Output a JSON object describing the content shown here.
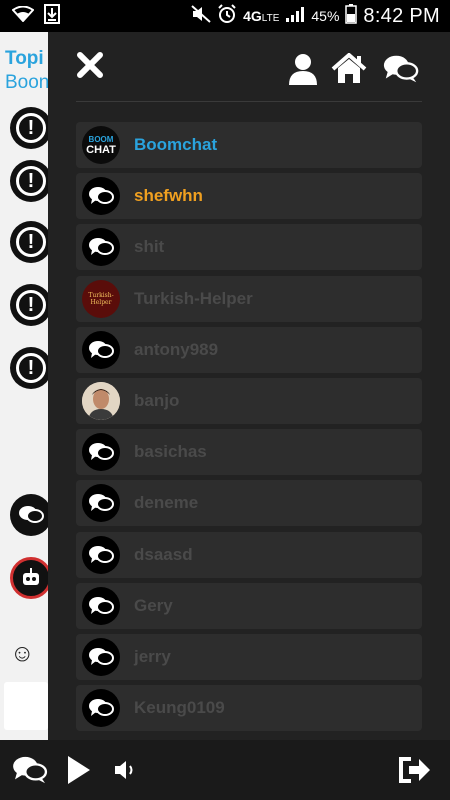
{
  "status": {
    "network": "4G",
    "lte": "LTE",
    "battery": "45%",
    "time": "8:42 PM"
  },
  "background_page": {
    "topic_label": "Topi",
    "topic_sub": "Boon"
  },
  "drawer": {
    "items": [
      {
        "name": "Boomchat",
        "avatar": "boomchat-logo",
        "color": "#2aa3dd",
        "avatar_text_top": "BOOM",
        "avatar_text_bottom": "CHAT"
      },
      {
        "name": "shefwhn",
        "avatar": "chat-bubbles-icon",
        "color": "#f0a020"
      },
      {
        "name": "shit",
        "avatar": "chat-bubbles-icon",
        "color": "#4a4a4a"
      },
      {
        "name": "Turkish-Helper",
        "avatar": "turkish-helper-logo",
        "color": "#4a4a4a",
        "avatar_text": "Turkish-Helper"
      },
      {
        "name": "antony989",
        "avatar": "chat-bubbles-icon",
        "color": "#4a4a4a"
      },
      {
        "name": "banjo",
        "avatar": "user-photo",
        "color": "#4a4a4a"
      },
      {
        "name": "basichas",
        "avatar": "chat-bubbles-icon",
        "color": "#4a4a4a"
      },
      {
        "name": "deneme",
        "avatar": "chat-bubbles-icon",
        "color": "#4a4a4a"
      },
      {
        "name": "dsaasd",
        "avatar": "chat-bubbles-icon",
        "color": "#4a4a4a"
      },
      {
        "name": "Gery",
        "avatar": "chat-bubbles-icon",
        "color": "#4a4a4a"
      },
      {
        "name": "jerry",
        "avatar": "chat-bubbles-icon",
        "color": "#4a4a4a"
      },
      {
        "name": "Keung0109",
        "avatar": "chat-bubbles-icon",
        "color": "#4a4a4a"
      }
    ]
  }
}
